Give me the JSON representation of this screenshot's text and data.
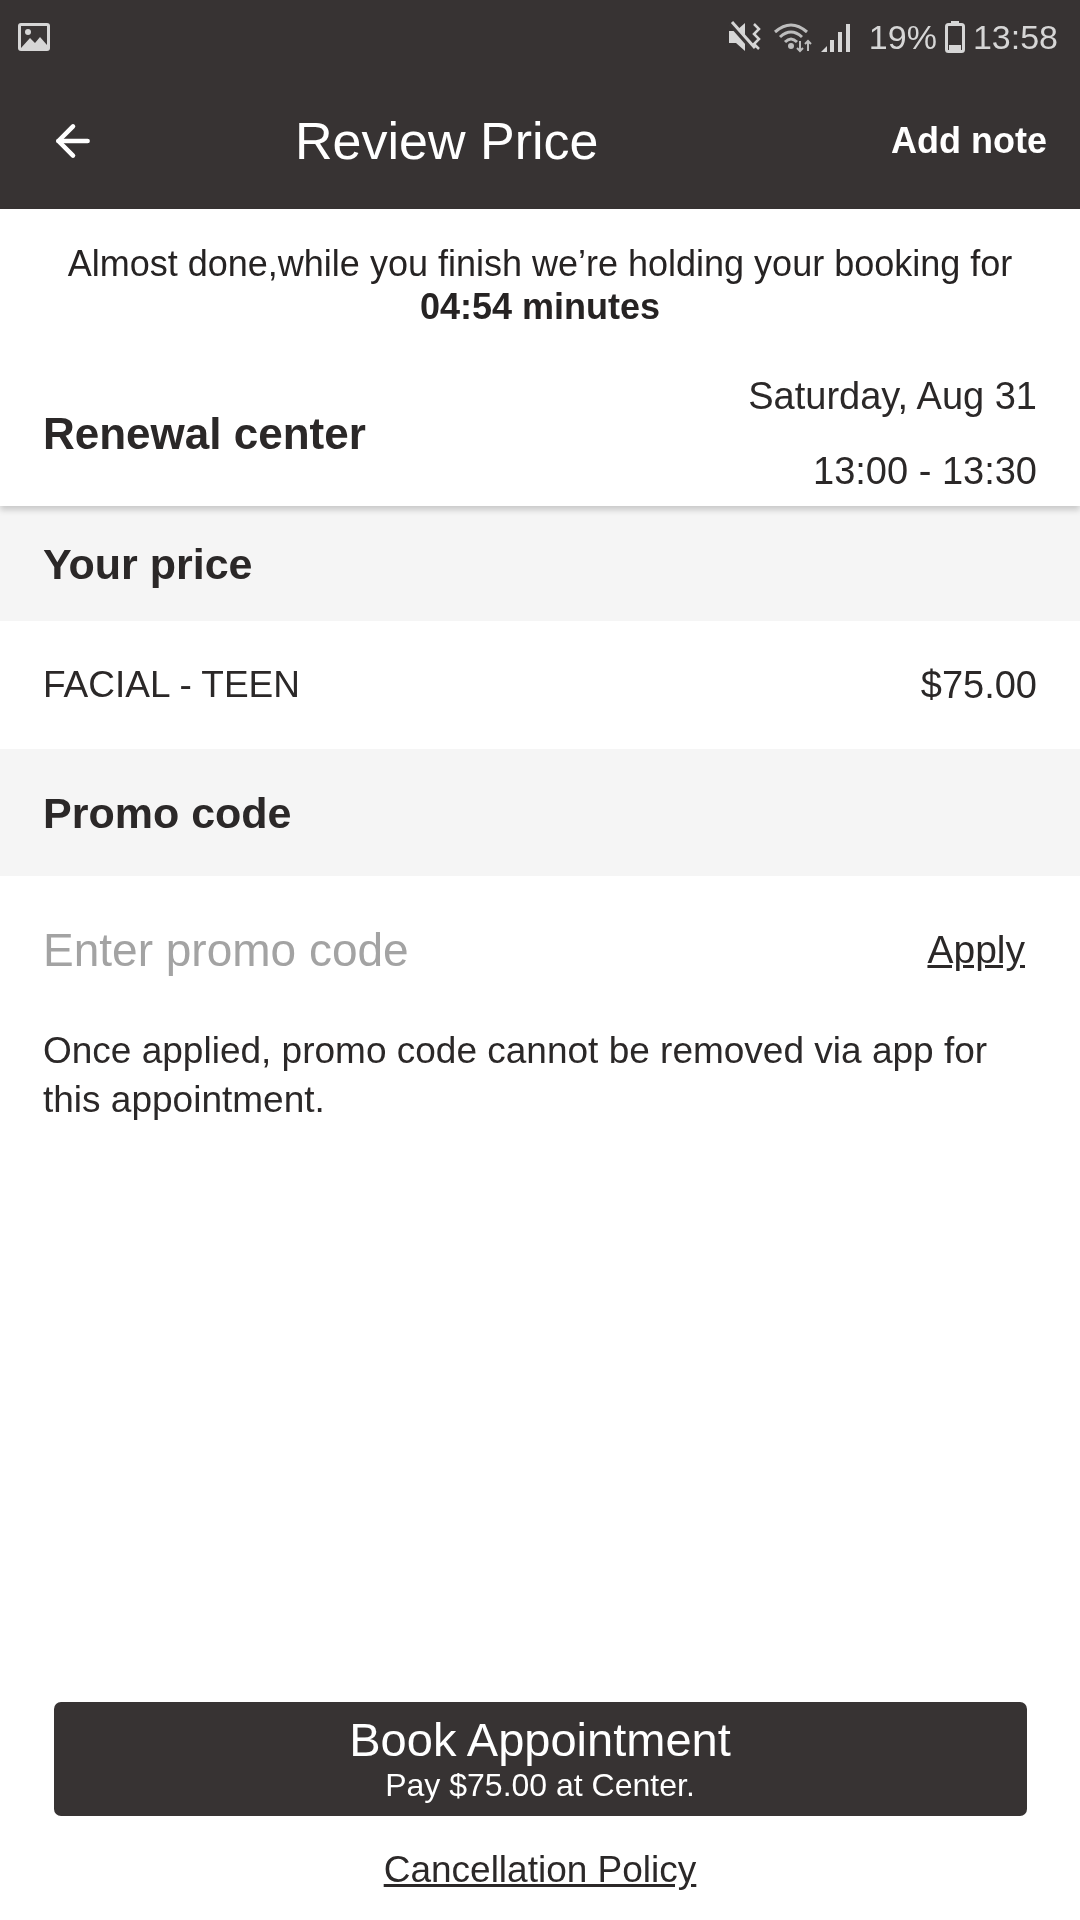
{
  "status_bar": {
    "battery": "19%",
    "time": "13:58"
  },
  "header": {
    "title": "Review Price",
    "action": "Add note"
  },
  "hold_notice": {
    "message": "Almost done,while you finish we’re holding your booking for",
    "countdown": "04:54 minutes"
  },
  "booking": {
    "center": "Renewal center",
    "date": "Saturday, Aug 31",
    "time": "13:00 - 13:30"
  },
  "price_section": {
    "title": "Your price",
    "items": [
      {
        "name": "FACIAL - TEEN",
        "price": "$75.00"
      }
    ]
  },
  "promo_section": {
    "title": "Promo code",
    "input": {
      "placeholder": "Enter promo code"
    },
    "apply": "Apply",
    "note": "Once applied, promo code cannot be removed via app for this appointment."
  },
  "book_button": {
    "label": "Book Appointment",
    "sublabel": "Pay $75.00 at Center."
  },
  "cancellation_link": "Cancellation Policy"
}
